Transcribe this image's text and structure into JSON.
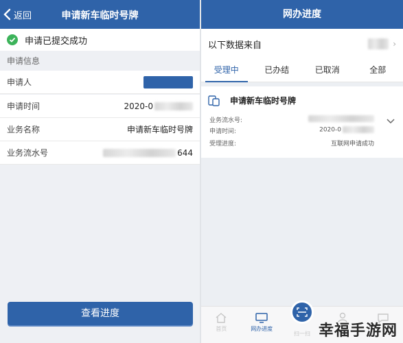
{
  "left": {
    "header": {
      "back_label": "返回",
      "title": "申请新车临时号牌"
    },
    "success_text": "申请已提交成功",
    "section_label": "申请信息",
    "rows": [
      {
        "label": "申请人",
        "value": ""
      },
      {
        "label": "申请时间",
        "value": "2020-0"
      },
      {
        "label": "业务名称",
        "value": "申请新车临时号牌"
      },
      {
        "label": "业务流水号",
        "value": "644"
      }
    ],
    "button_label": "查看进度"
  },
  "right": {
    "header_title": "网办进度",
    "source_label": "以下数据来自",
    "tabs": [
      "受理中",
      "已办结",
      "已取消",
      "全部"
    ],
    "active_tab": "受理中",
    "card": {
      "title": "申请新车临时号牌",
      "rows": [
        {
          "label": "业务流水号:",
          "value": ""
        },
        {
          "label": "申请时间:",
          "value": "2020-0"
        },
        {
          "label": "受理进度:",
          "value": "互联网申请成功"
        }
      ]
    },
    "nav": [
      {
        "label": "首页",
        "icon": "home-icon"
      },
      {
        "label": "网办进度",
        "icon": "monitor-icon"
      },
      {
        "label": "扫一扫",
        "icon": "scan-icon"
      },
      {
        "label": "",
        "icon": "user-icon"
      },
      {
        "label": "",
        "icon": "message-icon"
      }
    ]
  },
  "watermark": "幸福手游网",
  "colors": {
    "primary": "#2f63a9",
    "success": "#3cb35a"
  }
}
